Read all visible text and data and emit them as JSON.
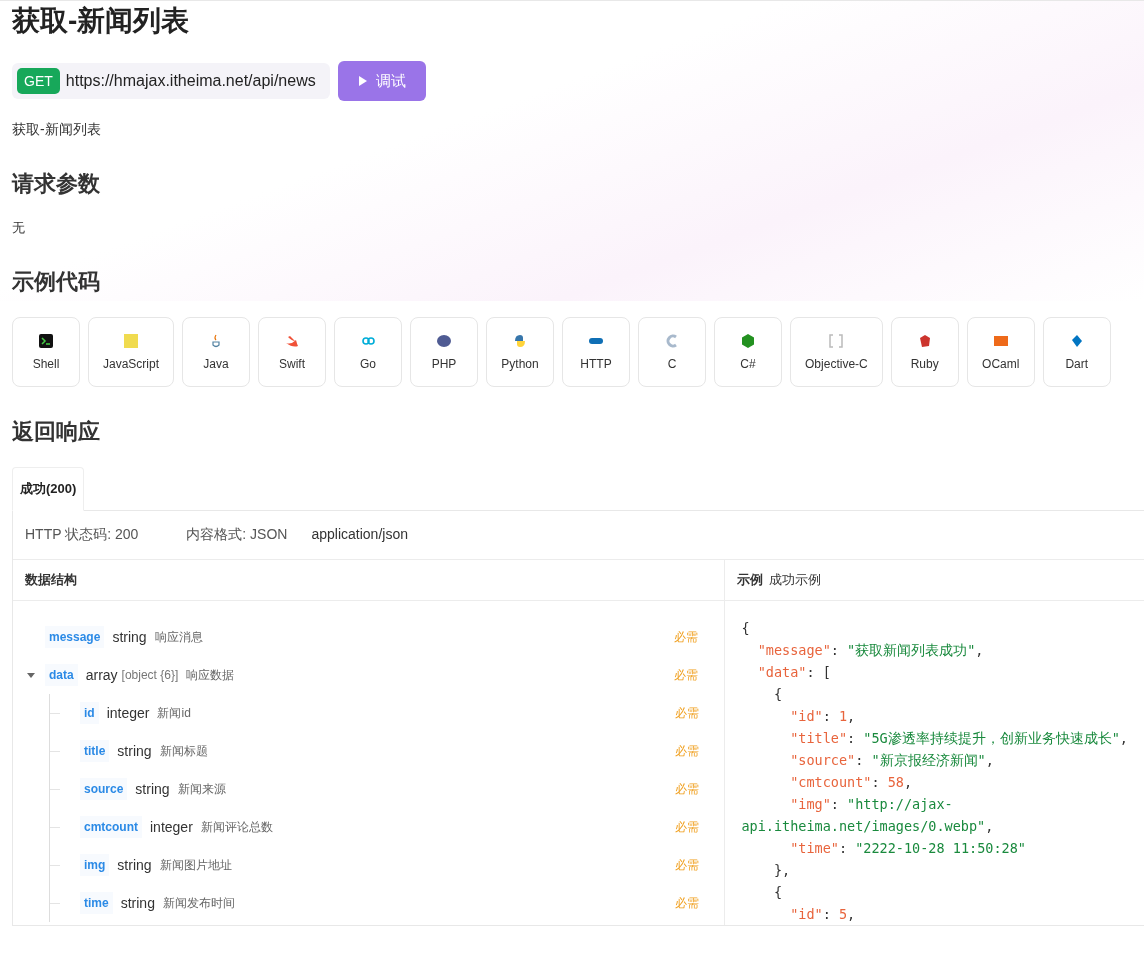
{
  "title": "获取-新闻列表",
  "request": {
    "method": "GET",
    "url": "https://hmajax.itheima.net/api/news",
    "button": "调试"
  },
  "description": "获取-新闻列表",
  "params": {
    "heading": "请求参数",
    "value": "无"
  },
  "examples": {
    "heading": "示例代码",
    "languages": [
      {
        "label": "Shell"
      },
      {
        "label": "JavaScript"
      },
      {
        "label": "Java"
      },
      {
        "label": "Swift"
      },
      {
        "label": "Go"
      },
      {
        "label": "PHP"
      },
      {
        "label": "Python"
      },
      {
        "label": "HTTP"
      },
      {
        "label": "C"
      },
      {
        "label": "C#"
      },
      {
        "label": "Objective-C"
      },
      {
        "label": "Ruby"
      },
      {
        "label": "OCaml"
      },
      {
        "label": "Dart"
      }
    ]
  },
  "response": {
    "heading": "返回响应",
    "tabs": [
      {
        "label": "成功(200)",
        "selected": true
      }
    ],
    "info": [
      "HTTP 状态码: 200",
      "内容格式: JSON",
      "application/json"
    ],
    "schema_heading": "数据结构",
    "fields": [
      {
        "name": "message",
        "type": "string",
        "desc": "响应消息",
        "required": "必需"
      },
      {
        "name": "data",
        "type": "array",
        "type_detail": "[object {6}]",
        "desc": "响应数据",
        "required": "必需",
        "expanded": true,
        "children": [
          {
            "name": "id",
            "type": "integer",
            "desc": "新闻id",
            "required": "必需"
          },
          {
            "name": "title",
            "type": "string",
            "desc": "新闻标题",
            "required": "必需"
          },
          {
            "name": "source",
            "type": "string",
            "desc": "新闻来源",
            "required": "必需"
          },
          {
            "name": "cmtcount",
            "type": "integer",
            "desc": "新闻评论总数",
            "required": "必需"
          },
          {
            "name": "img",
            "type": "string",
            "desc": "新闻图片地址",
            "required": "必需"
          },
          {
            "name": "time",
            "type": "string",
            "desc": "新闻发布时间",
            "required": "必需"
          }
        ]
      }
    ],
    "example_label": "示例",
    "example_name": "成功示例",
    "code_lines": [
      [
        {
          "t": "{",
          "kind": "p"
        }
      ],
      [
        {
          "t": "  \"message\"",
          "kind": "key"
        },
        {
          "t": ": ",
          "kind": "p"
        },
        {
          "t": "\"获取新闻列表成功\"",
          "kind": "str"
        },
        {
          "t": ",",
          "kind": "p"
        }
      ],
      [
        {
          "t": "  \"data\"",
          "kind": "key"
        },
        {
          "t": ": [",
          "kind": "p"
        }
      ],
      [
        {
          "t": "    {",
          "kind": "p"
        }
      ],
      [
        {
          "t": "      \"id\"",
          "kind": "key"
        },
        {
          "t": ": ",
          "kind": "p"
        },
        {
          "t": "1",
          "kind": "num"
        },
        {
          "t": ",",
          "kind": "p"
        }
      ],
      [
        {
          "t": "      \"title\"",
          "kind": "key"
        },
        {
          "t": ": ",
          "kind": "p"
        },
        {
          "t": "\"5G渗透率持续提升，创新业务快速成长\"",
          "kind": "str"
        },
        {
          "t": ",",
          "kind": "p"
        }
      ],
      [
        {
          "t": "      \"source\"",
          "kind": "key"
        },
        {
          "t": ": ",
          "kind": "p"
        },
        {
          "t": "\"新京报经济新闻\"",
          "kind": "str"
        },
        {
          "t": ",",
          "kind": "p"
        }
      ],
      [
        {
          "t": "      \"cmtcount\"",
          "kind": "key"
        },
        {
          "t": ": ",
          "kind": "p"
        },
        {
          "t": "58",
          "kind": "num"
        },
        {
          "t": ",",
          "kind": "p"
        }
      ],
      [
        {
          "t": "      \"img\"",
          "kind": "key"
        },
        {
          "t": ": ",
          "kind": "p"
        },
        {
          "t": "\"http://ajax-",
          "kind": "str"
        }
      ],
      [
        {
          "t": "api.itheima.net/images/0.webp\"",
          "kind": "str"
        },
        {
          "t": ",",
          "kind": "p"
        }
      ],
      [
        {
          "t": "      \"time\"",
          "kind": "key"
        },
        {
          "t": ": ",
          "kind": "p"
        },
        {
          "t": "\"2222-10-28 11:50:28\"",
          "kind": "str"
        }
      ],
      [
        {
          "t": "    },",
          "kind": "p"
        }
      ],
      [
        {
          "t": "    {",
          "kind": "p"
        }
      ],
      [
        {
          "t": "      \"id\"",
          "kind": "key"
        },
        {
          "t": ": ",
          "kind": "p"
        },
        {
          "t": "5",
          "kind": "num"
        },
        {
          "t": ",",
          "kind": "p"
        }
      ]
    ]
  }
}
